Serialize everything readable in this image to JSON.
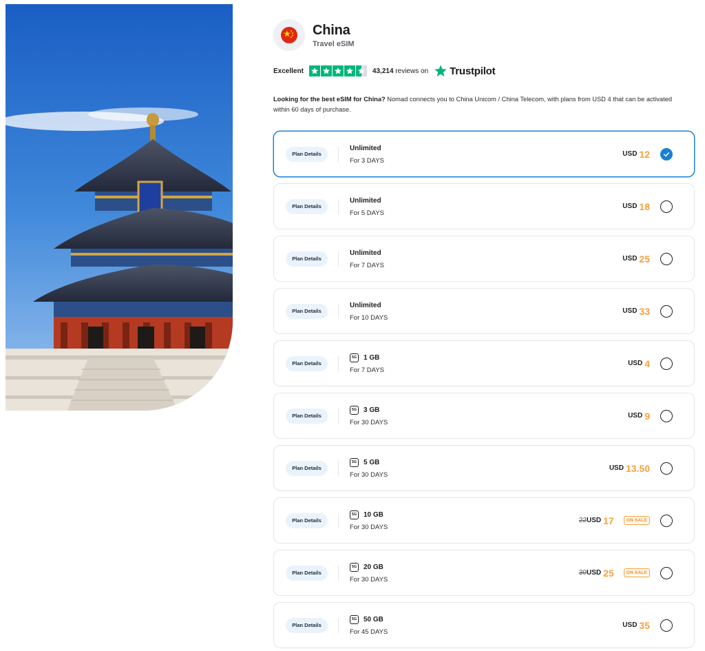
{
  "hero": {
    "image": "temple-of-heaven-photo"
  },
  "header": {
    "flag_icon": "china-flag-icon",
    "country": "China",
    "subtitle": "Travel eSIM"
  },
  "trust": {
    "rating_label": "Excellent",
    "stars": 4.5,
    "reviews_count": "43,214",
    "reviews_suffix": "reviews on",
    "brand": "Trustpilot",
    "brand_color": "#00b67a"
  },
  "description": {
    "lead": "Looking for the best eSIM for China?",
    "body": " Nomad connects you to China Unicom / China Telecom, with plans from USD 4 that can be activated within 60 days of purchase."
  },
  "colors": {
    "accent": "#1b7fd6",
    "price": "#f7a13b",
    "sale": "#f08a1c"
  },
  "plans": [
    {
      "details_label": "Plan Details",
      "name": "Unlimited",
      "duration": "For 3 DAYS",
      "currency": "USD",
      "price": "12",
      "old_price": "",
      "sale_label": "",
      "data_icon": false,
      "selected": true
    },
    {
      "details_label": "Plan Details",
      "name": "Unlimited",
      "duration": "For 5 DAYS",
      "currency": "USD",
      "price": "18",
      "old_price": "",
      "sale_label": "",
      "data_icon": false,
      "selected": false
    },
    {
      "details_label": "Plan Details",
      "name": "Unlimited",
      "duration": "For 7 DAYS",
      "currency": "USD",
      "price": "25",
      "old_price": "",
      "sale_label": "",
      "data_icon": false,
      "selected": false
    },
    {
      "details_label": "Plan Details",
      "name": "Unlimited",
      "duration": "For 10 DAYS",
      "currency": "USD",
      "price": "33",
      "old_price": "",
      "sale_label": "",
      "data_icon": false,
      "selected": false
    },
    {
      "details_label": "Plan Details",
      "name": "1 GB",
      "duration": "For 7 DAYS",
      "currency": "USD",
      "price": "4",
      "old_price": "",
      "sale_label": "",
      "data_icon": true,
      "selected": false
    },
    {
      "details_label": "Plan Details",
      "name": "3 GB",
      "duration": "For 30 DAYS",
      "currency": "USD",
      "price": "9",
      "old_price": "",
      "sale_label": "",
      "data_icon": true,
      "selected": false
    },
    {
      "details_label": "Plan Details",
      "name": "5 GB",
      "duration": "For 30 DAYS",
      "currency": "USD",
      "price": "13.50",
      "old_price": "",
      "sale_label": "",
      "data_icon": true,
      "selected": false
    },
    {
      "details_label": "Plan Details",
      "name": "10 GB",
      "duration": "For 30 DAYS",
      "currency": "USD",
      "price": "17",
      "old_price": "22",
      "sale_label": "ON SALE",
      "data_icon": true,
      "selected": false
    },
    {
      "details_label": "Plan Details",
      "name": "20 GB",
      "duration": "For 30 DAYS",
      "currency": "USD",
      "price": "25",
      "old_price": "30",
      "sale_label": "ON SALE",
      "data_icon": true,
      "selected": false
    },
    {
      "details_label": "Plan Details",
      "name": "50 GB",
      "duration": "For 45 DAYS",
      "currency": "USD",
      "price": "35",
      "old_price": "",
      "sale_label": "",
      "data_icon": true,
      "selected": false
    }
  ],
  "data_icon_text": "5G"
}
